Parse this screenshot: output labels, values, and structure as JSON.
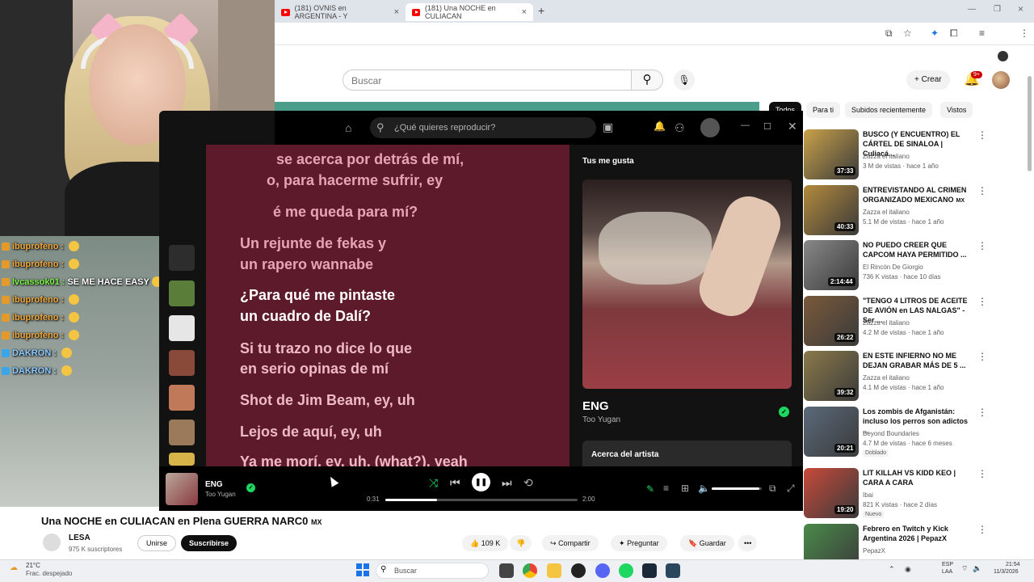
{
  "browser": {
    "tabs": [
      {
        "label": "(181) OVNIS en ARGENTINA - Y"
      },
      {
        "label": "(181) Una NOCHE en CULIACAN"
      }
    ],
    "new_tab": "+"
  },
  "youtube": {
    "search_placeholder": "Buscar",
    "create_label": "Crear",
    "notifications_badge": "9+",
    "chips": [
      "Todos",
      "Para ti",
      "Subidos recientemente",
      "Vistos"
    ],
    "video_title": "Una NOCHE en CULIACAN en Plena GUERRA NARC0",
    "video_title_suffix": "MX",
    "channel_name": "LESA",
    "channel_subs": "975 K suscriptores",
    "join_label": "Unirse",
    "subscribe_label": "Suscribirse",
    "likes": "109 K",
    "share_label": "Compartir",
    "ask_label": "Preguntar",
    "save_label": "Guardar",
    "recommendations": [
      {
        "title": "BUSCO (Y ENCUENTRO) EL CÁRTEL DE SINALOA | Culiacá...",
        "channel": "Zazza el italiano",
        "meta": "3 M de vistas · hace 1 año",
        "duration": "37:33",
        "color": "#c9a24a"
      },
      {
        "title": "ENTREVISTANDO AL CRIMEN ORGANIZADO MEXICANO",
        "title_suffix": "MX",
        "channel": "Zazza el italiano",
        "meta": "5.1 M de vistas · hace 1 año",
        "duration": "40:33",
        "color": "#b38a3c"
      },
      {
        "title": "NO PUEDO CREER QUE CAPCOM HAYA PERMITIDO ...",
        "channel": "El Rincón De Giorgio",
        "meta": "736 K vistas · hace 10 días",
        "duration": "2:14:44",
        "color": "#888888"
      },
      {
        "title": "\"TENGO 4 LITROS DE ACEITE DE AVIÓN en LAS NALGAS\" - Ser ...",
        "channel": "Zazza el italiano",
        "meta": "4.2 M de vistas · hace 1 año",
        "duration": "26:22",
        "color": "#7a5a3a"
      },
      {
        "title": "EN ESTE INFIERNO NO ME DEJAN GRABAR MÁS DE 5 ...",
        "channel": "Zazza el italiano",
        "meta": "4.1 M de vistas · hace 1 año",
        "duration": "39:32",
        "color": "#8a7a4a"
      },
      {
        "title": "Los zombis de Afganistán: incluso los perros son adictos ...",
        "channel": "Beyond Boundaries",
        "meta": "4.7 M de vistas · hace 6 meses",
        "duration": "20:21",
        "badge": "Doblado",
        "color": "#5a6a7a"
      },
      {
        "title": "LIT KILLAH VS KIDD KEO | CARA A CARA",
        "channel": "Ibai",
        "meta": "821 K vistas · hace 2 días",
        "duration": "19:20",
        "badge": "Nuevo",
        "color": "#c84a3a"
      },
      {
        "title": "Febrero en Twitch y Kick Argentina 2026 | PepazX",
        "channel": "PepazX",
        "meta": "",
        "duration": "",
        "color": "#4a8a4a"
      }
    ]
  },
  "chat": {
    "messages": [
      {
        "user": "ibuprofeno :",
        "text": "",
        "cls": ""
      },
      {
        "user": "ibuprofeno :",
        "text": "",
        "cls": ""
      },
      {
        "user": "lvcassok01 :",
        "text": "SE ME HACE EASY",
        "cls": "g"
      },
      {
        "user": "ibuprofeno :",
        "text": "",
        "cls": ""
      },
      {
        "user": "ibuprofeno :",
        "text": "",
        "cls": ""
      },
      {
        "user": "ibuprofeno :",
        "text": "",
        "cls": ""
      },
      {
        "user": "DAKRON :",
        "text": "",
        "cls": "b"
      },
      {
        "user": "DAKRON :",
        "text": "",
        "cls": "b"
      }
    ]
  },
  "spotify": {
    "search_placeholder": "¿Qué quieres reproducir?",
    "lyrics": [
      {
        "text": "se acerca por detrás de mí,",
        "state": "past"
      },
      {
        "text": "o, para hacerme sufrir, ey",
        "state": "past"
      },
      {
        "text": "é me queda para mí?",
        "state": "past"
      },
      {
        "text": "Un rejunte de fekas y",
        "state": "past"
      },
      {
        "text": "un rapero wannabe",
        "state": "past"
      },
      {
        "text": "¿Para qué me pintaste",
        "state": "cur"
      },
      {
        "text": "un cuadro de Dalí?",
        "state": "cur"
      },
      {
        "text": "Si tu trazo no dice lo que",
        "state": "dim"
      },
      {
        "text": "en serio opinas de mí",
        "state": "dim"
      },
      {
        "text": "Shot de Jim Beam, ey, uh",
        "state": "dim"
      },
      {
        "text": "Lejos de aquí, ey, uh",
        "state": "dim"
      },
      {
        "text": "Ya me morí, ey, uh, (what?), yeah",
        "state": "dim"
      }
    ],
    "panel_title": "Tus me gusta",
    "track_title": "ENG",
    "track_artist": "Too Yugan",
    "about_artist": "Acerca del artista",
    "elapsed": "0:31",
    "total": "2:00",
    "progress": 0.27,
    "volume": 0.95
  },
  "taskbar": {
    "weather_temp": "21°C",
    "weather_desc": "Frac. despejado",
    "search_placeholder": "Buscar",
    "lang": "ESP",
    "lang2": "LAA",
    "time": "21:54",
    "date": "11/3/2026"
  }
}
